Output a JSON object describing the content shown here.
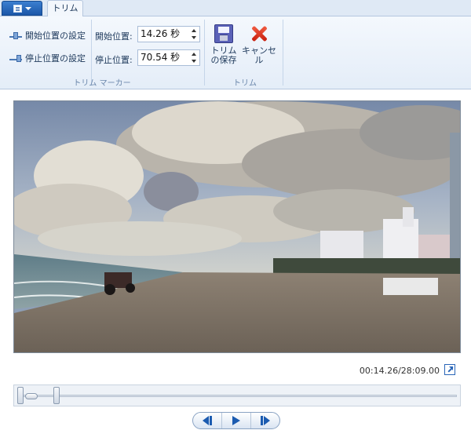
{
  "ribbon": {
    "tab_label": "トリム",
    "marker_group": {
      "label": "トリム マーカー",
      "set_start_label": "開始位置の設定",
      "set_end_label": "停止位置の設定",
      "start_label": "開始位置:",
      "start_value": "14.26 秒",
      "end_label": "停止位置:",
      "end_value": "70.54 秒"
    },
    "trim_group": {
      "label": "トリム",
      "save_label": "トリムの保存",
      "cancel_label": "キャンセル"
    }
  },
  "player": {
    "timecode": "00:14.26/28:09.00"
  },
  "icons": {
    "app_menu": "document-menu-icon",
    "marker": "trim-marker-icon",
    "save": "floppy-disk-icon",
    "cancel": "red-x-icon",
    "expand": "expand-icon",
    "prev": "previous-frame-icon",
    "play": "play-icon",
    "next": "next-frame-icon"
  },
  "colors": {
    "accent": "#1b5bb0",
    "cancel": "#d8301a"
  }
}
